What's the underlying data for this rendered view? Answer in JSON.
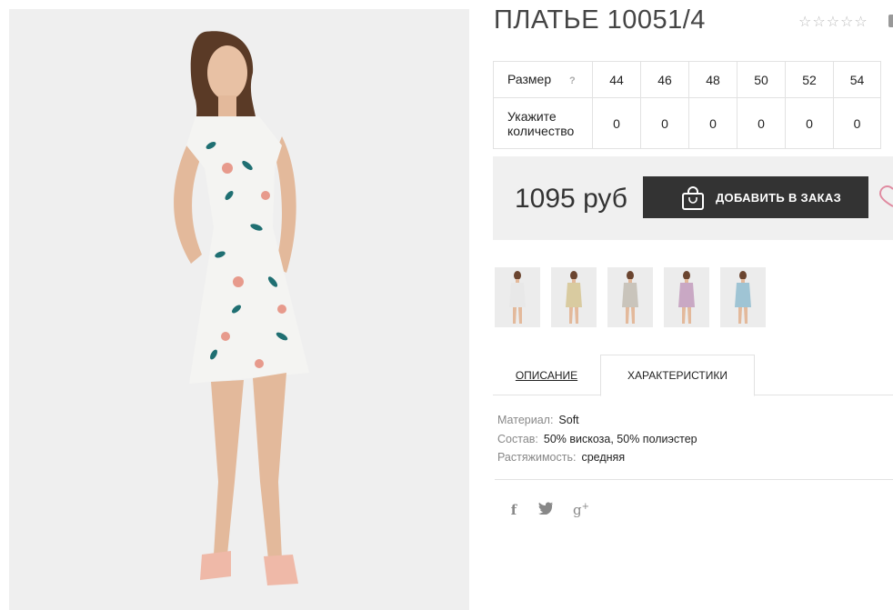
{
  "product": {
    "title": "ПЛАТЬЕ 10051/4",
    "rating_stars": "☆☆☆☆☆",
    "rating_value": 0
  },
  "size_table": {
    "size_label": "Размер",
    "help_icon": "?",
    "sizes": [
      "44",
      "46",
      "48",
      "50",
      "52",
      "54"
    ],
    "qty_label_line1": "Укажите",
    "qty_label_line2": "количество",
    "quantities": [
      "0",
      "0",
      "0",
      "0",
      "0",
      "0"
    ]
  },
  "purchase": {
    "price": "1095 руб",
    "add_button": "ДОБАВИТЬ В ЗАКАЗ",
    "cart_icon": "shopping-bag-icon",
    "wishlist_icon": "heart-icon"
  },
  "thumbnails": [
    {
      "name": "thumb-1",
      "dress_color": "#e8e8e8",
      "selected": true
    },
    {
      "name": "thumb-2",
      "dress_color": "#d9cba0"
    },
    {
      "name": "thumb-3",
      "dress_color": "#c9c4bb"
    },
    {
      "name": "thumb-4",
      "dress_color": "#c9a8c4"
    },
    {
      "name": "thumb-5",
      "dress_color": "#9fc4d4"
    }
  ],
  "tabs": {
    "description": "ОПИСАНИЕ",
    "characteristics": "ХАРАКТЕРИСТИКИ",
    "active": "characteristics"
  },
  "specs": [
    {
      "key": "Материал:",
      "value": "Soft"
    },
    {
      "key": "Состав:",
      "value": "50% вискоза, 50% полиэстер"
    },
    {
      "key": "Растяжимость:",
      "value": "средняя"
    }
  ],
  "social": {
    "facebook": "f",
    "twitter": "🐦",
    "google_plus": "g",
    "google_plus_sup": "+"
  },
  "colors": {
    "button_bg": "#333333",
    "buy_box_bg": "#f0f0f0",
    "border": "#e2e2e2",
    "heart": "#e08aa0",
    "photo_bg": "#eeeeee"
  }
}
